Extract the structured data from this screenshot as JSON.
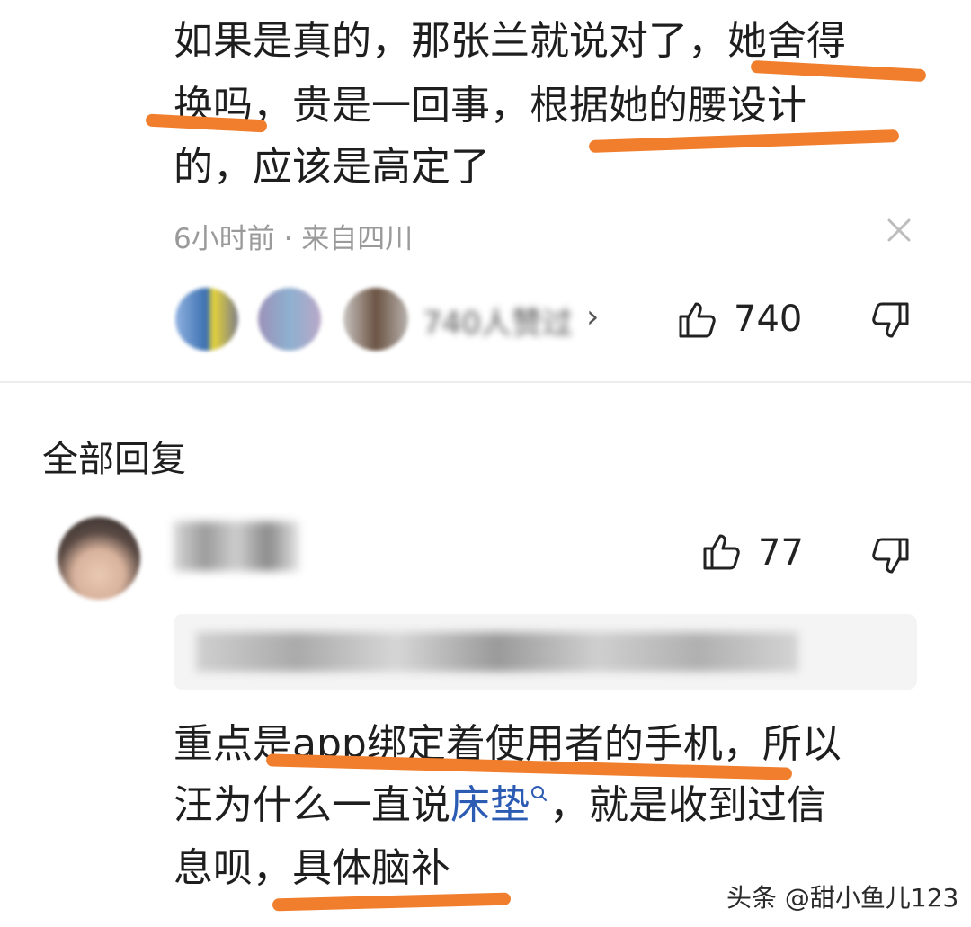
{
  "comment": {
    "line1": "如果是真的，那张兰就说对了，她舍得",
    "line2": "换吗，贵是一回事，根据她的腰设计",
    "line3": "的，应该是高定了",
    "meta": "6小时前 · 来自四川",
    "likers_text": "740人赞过",
    "likers_arrow": "›",
    "like_count": "740"
  },
  "replies_section": {
    "title": "全部回复"
  },
  "reply": {
    "like_count": "77",
    "quote_text": "@...",
    "line1": "重点是app绑定着使用者的手机，所以",
    "line2_before": "汪为什么一直说",
    "line2_link": "床垫",
    "line2_after": "，就是收到过信",
    "line3": "息呗，具体脑补"
  },
  "watermark": "头条 @甜小鱼儿123",
  "colors": {
    "highlight_underline": "#f07e2c",
    "link": "#2b5bb3",
    "meta_text": "#9a9a9a"
  },
  "icons": {
    "like": "thumbs-up-icon",
    "dislike": "thumbs-down-icon",
    "close": "close-icon",
    "search": "search-icon"
  }
}
